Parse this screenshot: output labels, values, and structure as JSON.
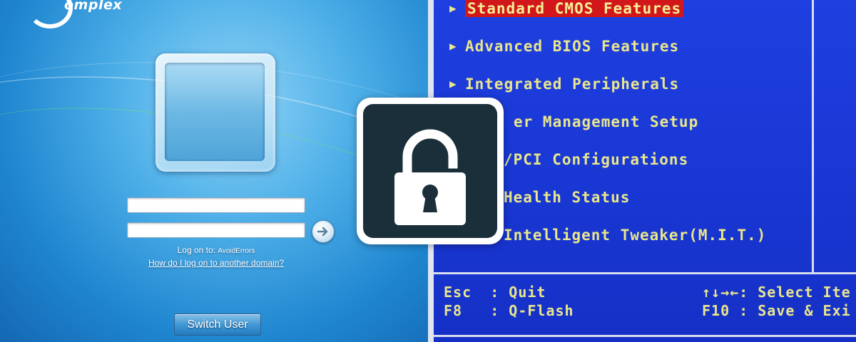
{
  "logon": {
    "brand": "omplex",
    "username_value": "",
    "password_value": "",
    "logon_label": "Log on to:",
    "logon_domain": "AvoidErrors",
    "domain_link": "How do I log on to another domain?",
    "switch_user": "Switch User"
  },
  "bios": {
    "menu": [
      {
        "label": "Standard CMOS Features",
        "selected": true
      },
      {
        "label": "Advanced BIOS Features",
        "selected": false
      },
      {
        "label": "Integrated Peripherals",
        "selected": false
      },
      {
        "label": "er Management Setup",
        "selected": false
      },
      {
        "label": "/PCI Configurations",
        "selected": false
      },
      {
        "label": "Health Status",
        "selected": false
      },
      {
        "label": "Intelligent Tweaker(M.I.T.)",
        "selected": false
      }
    ],
    "footer": {
      "esc_key": "Esc",
      "esc_action": ": Quit",
      "f8_key": "F8",
      "f8_action": ": Q-Flash",
      "arrows_key": "↑↓→←",
      "arrows_action": ": Select Ite",
      "f10_key": "F10",
      "f10_action": ": Save & Exi"
    },
    "colors": {
      "background": "#1836d2",
      "text": "#e9e68c",
      "highlight": "#d2171b"
    }
  },
  "badge": {
    "icon": "unlocked-padlock-icon",
    "color": "#1b2f3a"
  }
}
